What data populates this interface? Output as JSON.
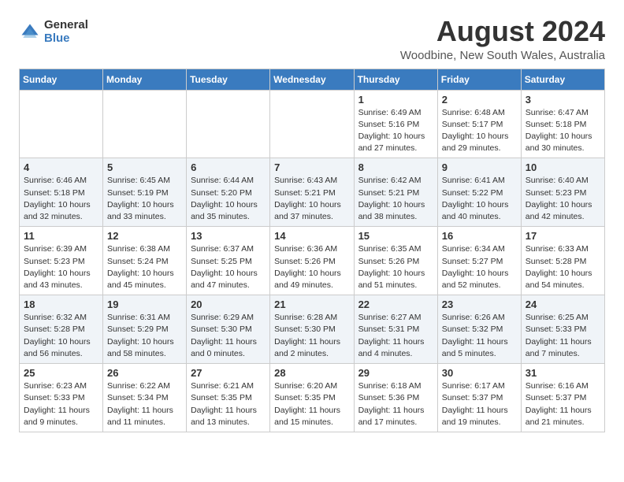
{
  "header": {
    "logo_general": "General",
    "logo_blue": "Blue",
    "month_title": "August 2024",
    "location": "Woodbine, New South Wales, Australia"
  },
  "weekdays": [
    "Sunday",
    "Monday",
    "Tuesday",
    "Wednesday",
    "Thursday",
    "Friday",
    "Saturday"
  ],
  "rows": [
    [
      {
        "day": "",
        "info": ""
      },
      {
        "day": "",
        "info": ""
      },
      {
        "day": "",
        "info": ""
      },
      {
        "day": "",
        "info": ""
      },
      {
        "day": "1",
        "info": "Sunrise: 6:49 AM\nSunset: 5:16 PM\nDaylight: 10 hours\nand 27 minutes."
      },
      {
        "day": "2",
        "info": "Sunrise: 6:48 AM\nSunset: 5:17 PM\nDaylight: 10 hours\nand 29 minutes."
      },
      {
        "day": "3",
        "info": "Sunrise: 6:47 AM\nSunset: 5:18 PM\nDaylight: 10 hours\nand 30 minutes."
      }
    ],
    [
      {
        "day": "4",
        "info": "Sunrise: 6:46 AM\nSunset: 5:18 PM\nDaylight: 10 hours\nand 32 minutes."
      },
      {
        "day": "5",
        "info": "Sunrise: 6:45 AM\nSunset: 5:19 PM\nDaylight: 10 hours\nand 33 minutes."
      },
      {
        "day": "6",
        "info": "Sunrise: 6:44 AM\nSunset: 5:20 PM\nDaylight: 10 hours\nand 35 minutes."
      },
      {
        "day": "7",
        "info": "Sunrise: 6:43 AM\nSunset: 5:21 PM\nDaylight: 10 hours\nand 37 minutes."
      },
      {
        "day": "8",
        "info": "Sunrise: 6:42 AM\nSunset: 5:21 PM\nDaylight: 10 hours\nand 38 minutes."
      },
      {
        "day": "9",
        "info": "Sunrise: 6:41 AM\nSunset: 5:22 PM\nDaylight: 10 hours\nand 40 minutes."
      },
      {
        "day": "10",
        "info": "Sunrise: 6:40 AM\nSunset: 5:23 PM\nDaylight: 10 hours\nand 42 minutes."
      }
    ],
    [
      {
        "day": "11",
        "info": "Sunrise: 6:39 AM\nSunset: 5:23 PM\nDaylight: 10 hours\nand 43 minutes."
      },
      {
        "day": "12",
        "info": "Sunrise: 6:38 AM\nSunset: 5:24 PM\nDaylight: 10 hours\nand 45 minutes."
      },
      {
        "day": "13",
        "info": "Sunrise: 6:37 AM\nSunset: 5:25 PM\nDaylight: 10 hours\nand 47 minutes."
      },
      {
        "day": "14",
        "info": "Sunrise: 6:36 AM\nSunset: 5:26 PM\nDaylight: 10 hours\nand 49 minutes."
      },
      {
        "day": "15",
        "info": "Sunrise: 6:35 AM\nSunset: 5:26 PM\nDaylight: 10 hours\nand 51 minutes."
      },
      {
        "day": "16",
        "info": "Sunrise: 6:34 AM\nSunset: 5:27 PM\nDaylight: 10 hours\nand 52 minutes."
      },
      {
        "day": "17",
        "info": "Sunrise: 6:33 AM\nSunset: 5:28 PM\nDaylight: 10 hours\nand 54 minutes."
      }
    ],
    [
      {
        "day": "18",
        "info": "Sunrise: 6:32 AM\nSunset: 5:28 PM\nDaylight: 10 hours\nand 56 minutes."
      },
      {
        "day": "19",
        "info": "Sunrise: 6:31 AM\nSunset: 5:29 PM\nDaylight: 10 hours\nand 58 minutes."
      },
      {
        "day": "20",
        "info": "Sunrise: 6:29 AM\nSunset: 5:30 PM\nDaylight: 11 hours\nand 0 minutes."
      },
      {
        "day": "21",
        "info": "Sunrise: 6:28 AM\nSunset: 5:30 PM\nDaylight: 11 hours\nand 2 minutes."
      },
      {
        "day": "22",
        "info": "Sunrise: 6:27 AM\nSunset: 5:31 PM\nDaylight: 11 hours\nand 4 minutes."
      },
      {
        "day": "23",
        "info": "Sunrise: 6:26 AM\nSunset: 5:32 PM\nDaylight: 11 hours\nand 5 minutes."
      },
      {
        "day": "24",
        "info": "Sunrise: 6:25 AM\nSunset: 5:33 PM\nDaylight: 11 hours\nand 7 minutes."
      }
    ],
    [
      {
        "day": "25",
        "info": "Sunrise: 6:23 AM\nSunset: 5:33 PM\nDaylight: 11 hours\nand 9 minutes."
      },
      {
        "day": "26",
        "info": "Sunrise: 6:22 AM\nSunset: 5:34 PM\nDaylight: 11 hours\nand 11 minutes."
      },
      {
        "day": "27",
        "info": "Sunrise: 6:21 AM\nSunset: 5:35 PM\nDaylight: 11 hours\nand 13 minutes."
      },
      {
        "day": "28",
        "info": "Sunrise: 6:20 AM\nSunset: 5:35 PM\nDaylight: 11 hours\nand 15 minutes."
      },
      {
        "day": "29",
        "info": "Sunrise: 6:18 AM\nSunset: 5:36 PM\nDaylight: 11 hours\nand 17 minutes."
      },
      {
        "day": "30",
        "info": "Sunrise: 6:17 AM\nSunset: 5:37 PM\nDaylight: 11 hours\nand 19 minutes."
      },
      {
        "day": "31",
        "info": "Sunrise: 6:16 AM\nSunset: 5:37 PM\nDaylight: 11 hours\nand 21 minutes."
      }
    ]
  ]
}
